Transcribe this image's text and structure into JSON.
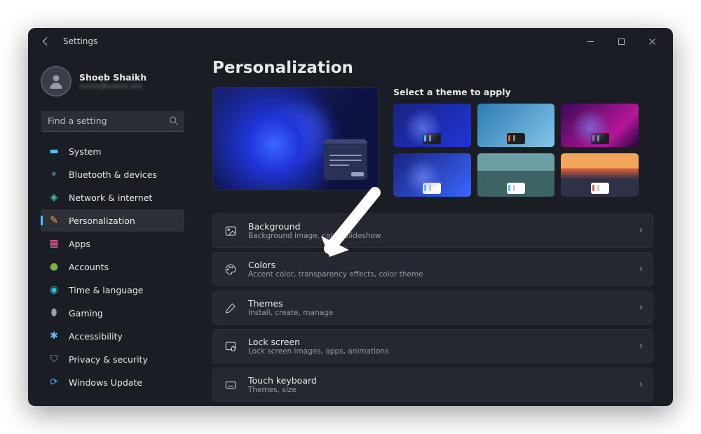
{
  "titlebar": {
    "title": "Settings"
  },
  "user": {
    "name": "Shoeb Shaikh",
    "email": "xxxxx@xxxxx.xxx"
  },
  "search": {
    "placeholder": "Find a setting"
  },
  "sidebar": {
    "items": [
      {
        "label": "System"
      },
      {
        "label": "Bluetooth & devices"
      },
      {
        "label": "Network & internet"
      },
      {
        "label": "Personalization"
      },
      {
        "label": "Apps"
      },
      {
        "label": "Accounts"
      },
      {
        "label": "Time & language"
      },
      {
        "label": "Gaming"
      },
      {
        "label": "Accessibility"
      },
      {
        "label": "Privacy & security"
      },
      {
        "label": "Windows Update"
      }
    ],
    "active_index": 3
  },
  "main": {
    "title": "Personalization",
    "themes_header": "Select a theme to apply",
    "rows": [
      {
        "title": "Background",
        "subtitle": "Background image, color, slideshow"
      },
      {
        "title": "Colors",
        "subtitle": "Accent color, transparency effects, color theme"
      },
      {
        "title": "Themes",
        "subtitle": "Install, create, manage"
      },
      {
        "title": "Lock screen",
        "subtitle": "Lock screen images, apps, animations"
      },
      {
        "title": "Touch keyboard",
        "subtitle": "Themes, size"
      }
    ]
  },
  "sidebar_icons": {
    "system": "🖥️",
    "bluetooth": "ᚼ",
    "network": "📶",
    "personalization": "✏️",
    "apps": "🔲",
    "accounts": "👤",
    "time": "🌐",
    "gaming": "🎮",
    "accessibility": "♿",
    "privacy": "🔒",
    "update": "🔄"
  }
}
